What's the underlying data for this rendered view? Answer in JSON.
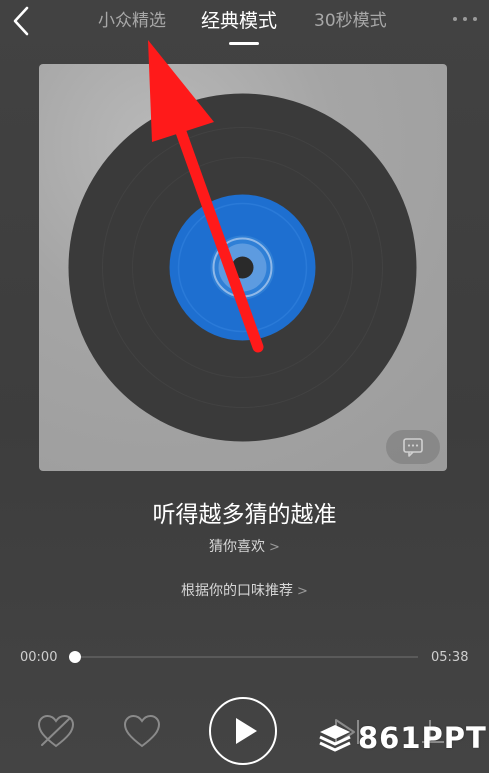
{
  "header": {
    "tabs": [
      {
        "label": "小众精选",
        "active": false
      },
      {
        "label": "经典模式",
        "active": true
      },
      {
        "label": "30秒模式",
        "active": false
      }
    ]
  },
  "song": {
    "title": "听得越多猜的越准",
    "subtitle": "猜你喜欢",
    "recommendation": "根据你的口味推荐"
  },
  "player": {
    "current_time": "00:00",
    "total_time": "05:38",
    "progress": 0
  },
  "icons": {
    "back": "chevron-left-icon",
    "more": "more-dots-icon",
    "comment": "comment-icon",
    "dislike": "dislike-heart-icon",
    "like": "heart-icon",
    "play": "play-icon",
    "next": "next-track-icon",
    "list": "playlist-icon"
  },
  "colors": {
    "vinyl": "#3a3a3a",
    "label": "#1e6fd0",
    "annotation_arrow": "#ff1a1a"
  },
  "watermark": {
    "text": "861PPT"
  }
}
